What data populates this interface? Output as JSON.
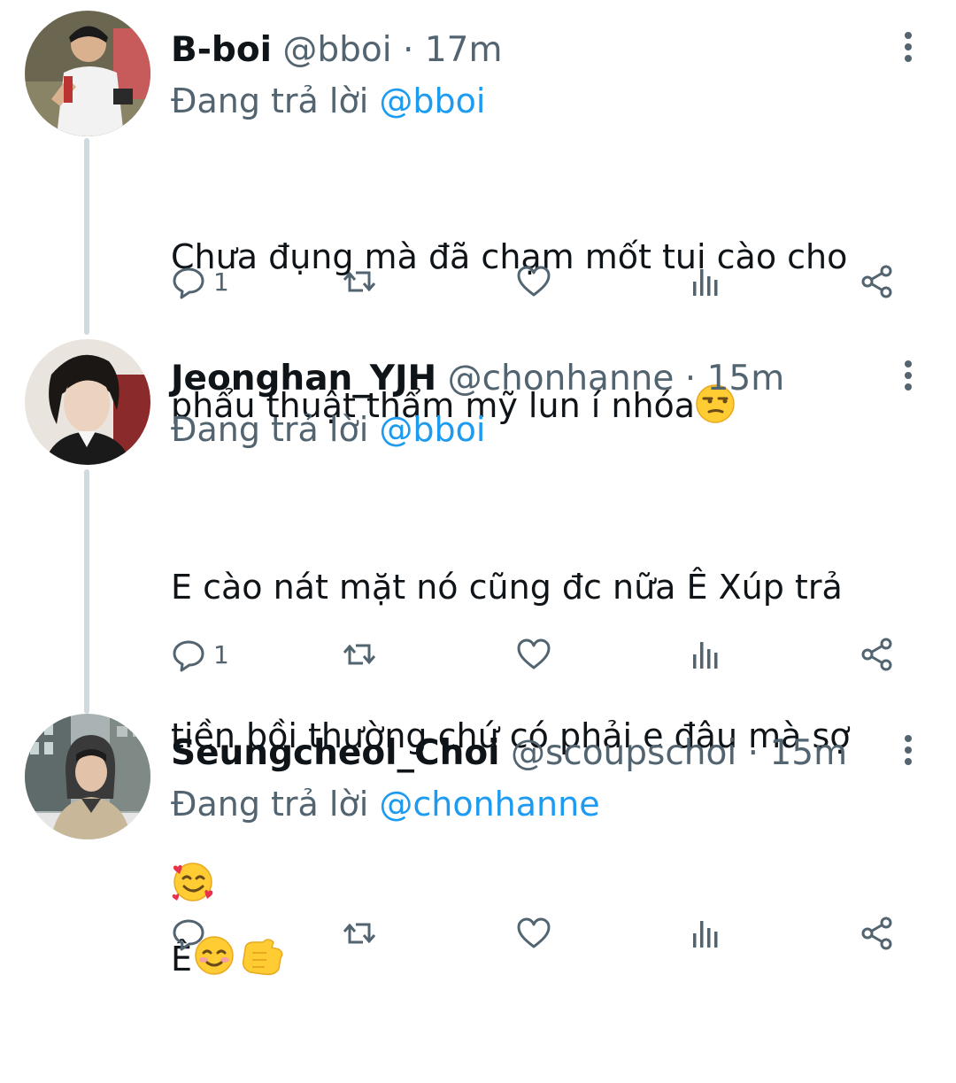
{
  "tweets": [
    {
      "name": "B-boi",
      "handle": "@bboi",
      "separator": "·",
      "time": "17m",
      "reply_prefix": "Đang trả lời",
      "reply_to": "@bboi",
      "text_line1": "Chưa đụng mà đã chạm mốt tui cào cho",
      "text_line2": "phẩu thuật thẩm mỹ lun í nhóa",
      "reply_count": "1"
    },
    {
      "name": "Jeonghan_YJH",
      "handle": "@chonhanne",
      "separator": "·",
      "time": "15m",
      "reply_prefix": "Đang trả lời",
      "reply_to": "@bboi",
      "text_line1": "E cào nát mặt nó cũng đc nữa Ê Xúp trả",
      "text_line2": "tiền bồi thường chứ có phải e đâu mà sợ",
      "reply_count": "1"
    },
    {
      "name": "Seungcheol_Choi",
      "handle": "@scoupschoi",
      "separator": "·",
      "time": "15m",
      "reply_prefix": "Đang trả lời",
      "reply_to": "@chonhanne",
      "text_line1": "Ê",
      "reply_count": ""
    }
  ],
  "icons": {
    "reply": "reply-icon",
    "retweet": "retweet-icon",
    "like": "heart-icon",
    "views": "views-icon",
    "share": "share-icon",
    "more": "more-vertical-icon"
  },
  "colors": {
    "mention": "#1d9bf0",
    "secondary_text": "#536471",
    "thread_line": "#cfd9de"
  }
}
